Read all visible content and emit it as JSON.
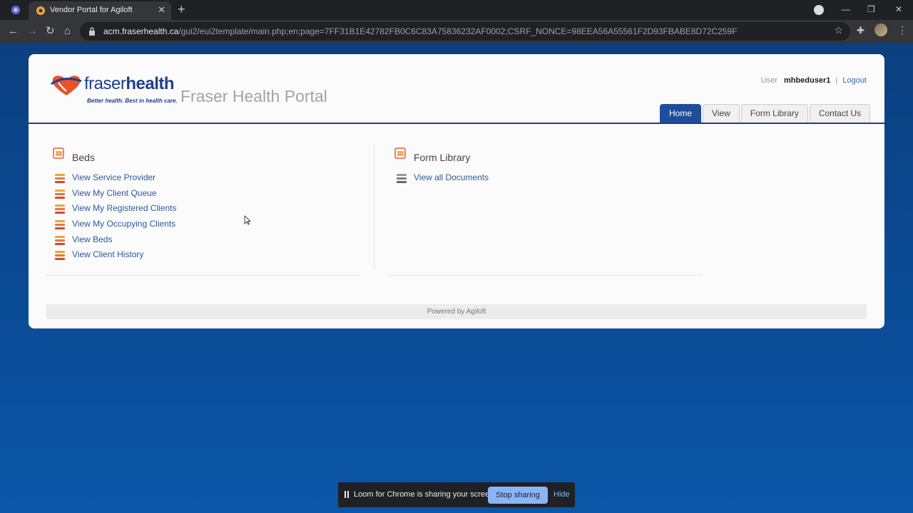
{
  "browser": {
    "tab_title": "Vendor Portal for Agiloft",
    "new_tab": "+",
    "tab_close": "✕",
    "url_host": "acm.fraserhealth.ca",
    "url_path": "/gui2/eui2template/main.php;en;page=7FF31B1E42782FB0C6C83A75836232AF0002;CSRF_NONCE=98EEA56A55561F2D93FBABE8D72C259F",
    "window_controls": {
      "minimize": "—",
      "maximize": "❐",
      "close": "✕"
    }
  },
  "header": {
    "logo_text_light": "fraser",
    "logo_text_bold": "health",
    "logo_tagline": "Better health. Best in health care.",
    "portal_title": "Fraser Health Portal",
    "user_label": "User",
    "user_name": "mhbeduser1",
    "separator": "|",
    "logout": "Logout"
  },
  "tabs": [
    {
      "label": "Home",
      "active": true
    },
    {
      "label": "View",
      "active": false
    },
    {
      "label": "Form Library",
      "active": false
    },
    {
      "label": "Contact Us",
      "active": false
    }
  ],
  "beds": {
    "title": "Beds",
    "links": [
      "View Service Provider",
      "View My Client Queue",
      "View My Registered Clients",
      "View My Occupying Clients",
      "View Beds",
      "View Client History"
    ]
  },
  "form_library": {
    "title": "Form Library",
    "links": [
      "View all Documents"
    ]
  },
  "footer": {
    "text": "Powered by Agiloft"
  },
  "loom": {
    "message": "Loom for Chrome is sharing your screen.",
    "stop_label": "Stop sharing",
    "hide_label": "Hide"
  },
  "colors": {
    "page_bg": "#0b4c9a",
    "accent": "#1f4d9b",
    "link": "#2a5a9a"
  }
}
